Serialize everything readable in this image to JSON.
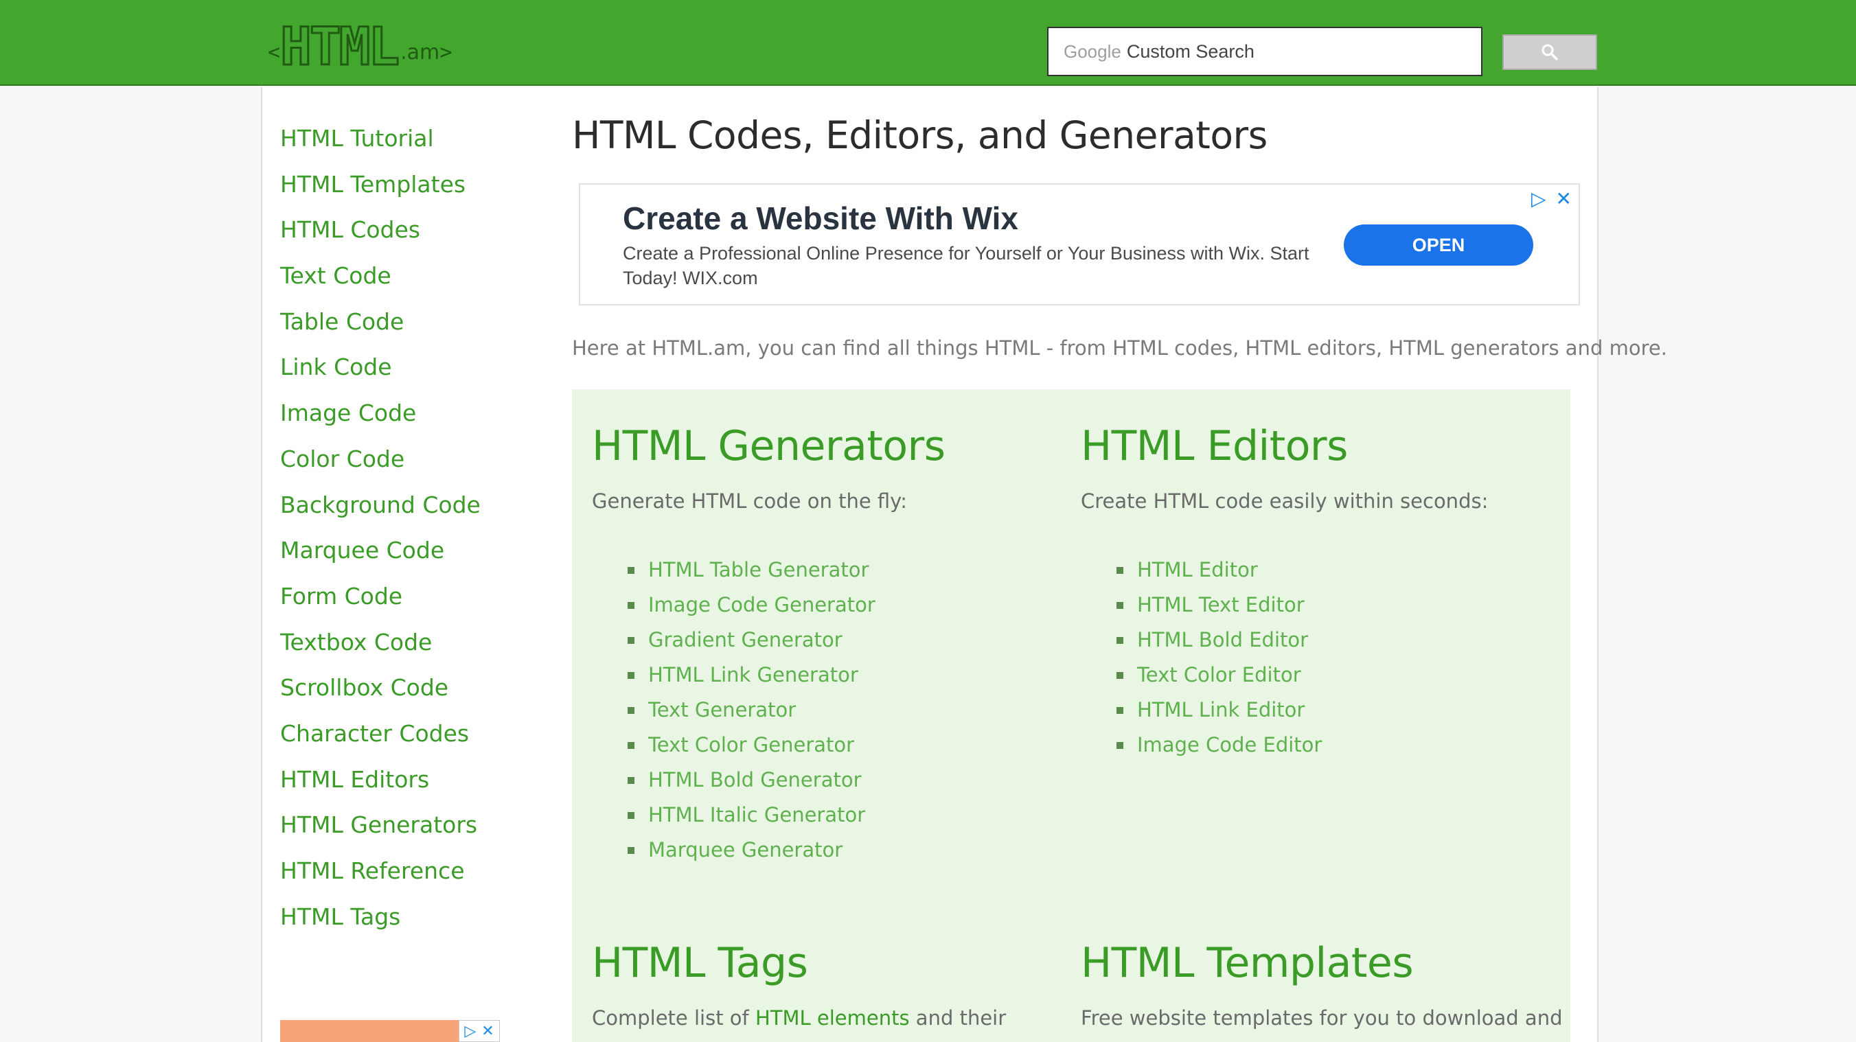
{
  "header": {
    "logo": {
      "lt": "<",
      "main": "HTML",
      "am": ".am",
      "gt": ">"
    },
    "search": {
      "brand": "Google",
      "placeholder": "Custom Search",
      "button_icon": "search-icon"
    }
  },
  "sidebar": {
    "items": [
      "HTML Tutorial",
      "HTML Templates",
      "HTML Codes",
      "Text Code",
      "Table Code",
      "Link Code",
      "Image Code",
      "Color Code",
      "Background Code",
      "Marquee Code",
      "Form Code",
      "Textbox Code",
      "Scrollbox Code",
      "Character Codes",
      "HTML Editors",
      "HTML Generators",
      "HTML Reference",
      "HTML Tags"
    ]
  },
  "main": {
    "title": "HTML Codes, Editors, and Generators",
    "ad": {
      "headline": "Create a Website With Wix",
      "description": "Create a Professional Online Presence for Yourself or Your Business with Wix. Start Today! WIX.com",
      "button": "OPEN"
    },
    "intro": "Here at HTML.am, you can find all things HTML - from HTML codes, HTML editors, HTML generators and more.",
    "generators": {
      "title": "HTML Generators",
      "subtitle": "Generate HTML code on the fly:",
      "items": [
        "HTML Table Generator",
        "Image Code Generator",
        "Gradient Generator",
        "HTML Link Generator",
        "Text Generator",
        "Text Color Generator",
        "HTML Bold Generator",
        "HTML Italic Generator",
        "Marquee Generator"
      ]
    },
    "editors": {
      "title": "HTML Editors",
      "subtitle": "Create HTML code easily within seconds:",
      "items": [
        "HTML Editor",
        "HTML Text Editor",
        "HTML Bold Editor",
        "Text Color Editor",
        "HTML Link Editor",
        "Image Code Editor"
      ]
    },
    "tags": {
      "title": "HTML Tags",
      "subtitle_pre": "Complete list of ",
      "subtitle_link": "HTML elements",
      "subtitle_post": " and their"
    },
    "templates": {
      "title": "HTML Templates",
      "subtitle": "Free website templates for you to download and"
    }
  },
  "colors": {
    "brand_green": "#43a62f",
    "link_green": "#3a9b26",
    "panel_bg": "#e8f6e3",
    "ad_button": "#1a73e8"
  }
}
